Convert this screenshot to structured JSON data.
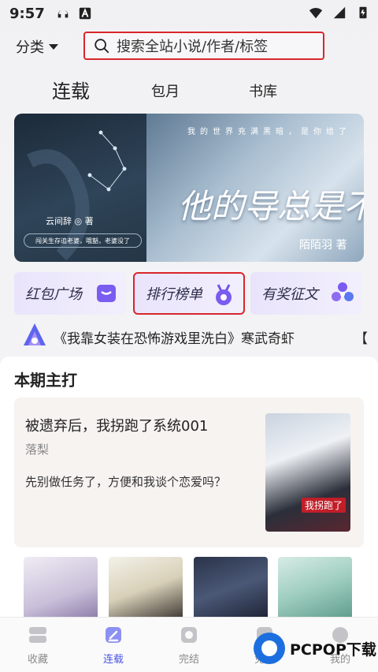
{
  "status": {
    "time": "9:57"
  },
  "topbar": {
    "category_label": "分类",
    "search_placeholder": "搜索全站小说/作者/标签"
  },
  "tabs": [
    {
      "label": "连载",
      "active": true
    },
    {
      "label": "包月",
      "active": false
    },
    {
      "label": "书库",
      "active": false
    }
  ],
  "banner": {
    "left_byline": "云间辞 ◎ 著",
    "left_tag": "闯关生存追老婆，哦豁，老婆没了",
    "right_top_line": "我的世界充满黑暗，是你给了",
    "right_title": "他的导总是不",
    "right_author": "陌陌羽 著"
  },
  "shortcuts": [
    {
      "label": "红包广场",
      "icon": "red-packet-icon"
    },
    {
      "label": "排行榜单",
      "icon": "ranking-medal-icon"
    },
    {
      "label": "有奖征文",
      "icon": "contest-flower-icon"
    }
  ],
  "ticker": {
    "text": "《我靠女装在恐怖游戏里洗白》寒武奇虾",
    "next_text": "【"
  },
  "main": {
    "section_title": "本期主打",
    "feature": {
      "title": "被遗弃后，我拐跑了系统001",
      "author": "落梨",
      "desc": "先别做任务了，方便和我谈个恋爱吗？",
      "cover_badge": "我拐跑了"
    }
  },
  "bottom_nav": [
    {
      "label": "收藏",
      "icon": "bookshelf-icon",
      "active": false
    },
    {
      "label": "连载",
      "icon": "edit-icon",
      "active": true
    },
    {
      "label": "完结",
      "icon": "finished-book-icon",
      "active": false
    },
    {
      "label": "免费",
      "icon": "free-icon",
      "active": false
    },
    {
      "label": "我的",
      "icon": "profile-icon",
      "active": false
    }
  ],
  "watermark": {
    "text": "PCPOP下载"
  },
  "colors": {
    "accent": "#4c54e6",
    "highlight_border": "#d8262c",
    "shortcut_bg": "#ece8fb"
  }
}
